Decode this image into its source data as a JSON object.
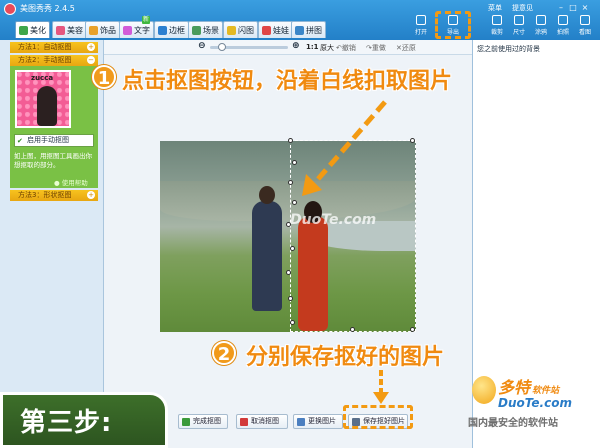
{
  "app": {
    "title": "美图秀秀 2.4.5"
  },
  "tabs": [
    {
      "label": "美化",
      "color": "#3fa64a"
    },
    {
      "label": "美容",
      "color": "#e6577f"
    },
    {
      "label": "饰品",
      "color": "#e8a12a"
    },
    {
      "label": "文字",
      "color": "#d15bd8"
    },
    {
      "label": "边框",
      "color": "#2b7fd0"
    },
    {
      "label": "场景",
      "color": "#4a9b5c"
    },
    {
      "label": "闪图",
      "color": "#e4b923"
    },
    {
      "label": "娃娃",
      "color": "#e04646"
    },
    {
      "label": "拼图",
      "color": "#3a86c8"
    }
  ],
  "tab_badge": "新",
  "menu": {
    "menu_label": "菜单",
    "feedback_label": "提意见"
  },
  "right_tools": [
    {
      "label": "打开"
    },
    {
      "label": "导出"
    },
    {
      "label": "裁剪"
    },
    {
      "label": "尺寸"
    },
    {
      "label": "涂鸦"
    },
    {
      "label": "拍照"
    },
    {
      "label": "看图"
    }
  ],
  "window_controls": {
    "minimize": "–",
    "maximize": "□",
    "close": "×"
  },
  "zoom": {
    "ratio_label": "1:1",
    "original_label": "原大",
    "undo_label": "撤销",
    "redo_label": "重做",
    "reset_label": "还原"
  },
  "left_panel": {
    "method1": "方法1：自动抠图",
    "method2": "方法2：手动抠图",
    "method3": "方法3：形状抠图",
    "thumb_caption": "zucca",
    "manual_button": "启用手动抠图",
    "description": "如上图，用抠图工具画出你想抠取的部分。",
    "help": "使用帮助"
  },
  "right_panel": {
    "recent_label": "您之前使用过的背景"
  },
  "annotations": {
    "step1_number": "1",
    "step1_text": "点击抠图按钮，沿着白线扣取图片",
    "step2_number": "2",
    "step2_text": "分别保存抠好的图片",
    "step3_text": "第三步:"
  },
  "photo_watermark": "DuoTe.com",
  "bottom_buttons": {
    "finish": "完成抠图",
    "cancel": "取消抠图",
    "replace": "更换图片",
    "save": "保存抠好图片"
  },
  "site_logo": {
    "line1": "多特",
    "line1_small": "软件站",
    "line2": "DuoTe.com",
    "line3": "国内最安全的软件站"
  }
}
